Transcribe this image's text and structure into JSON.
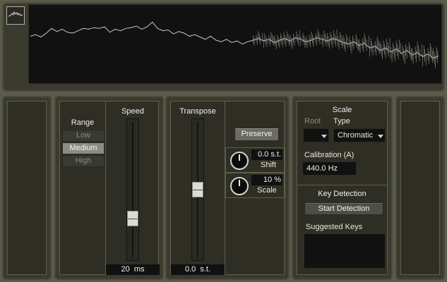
{
  "waveform": {
    "icon": "waveform-icon",
    "points": [
      0.4,
      0.38,
      0.41,
      0.36,
      0.3,
      0.34,
      0.31,
      0.35,
      0.36,
      0.33,
      0.3,
      0.31,
      0.29,
      0.3,
      0.28,
      0.35,
      0.31,
      0.33,
      0.3,
      0.29,
      0.27,
      0.31,
      0.28,
      0.22,
      0.3,
      0.33,
      0.32,
      0.37,
      0.34,
      0.36,
      0.4,
      0.38,
      0.41,
      0.44,
      0.4,
      0.45,
      0.47,
      0.44,
      0.48,
      0.46,
      0.5,
      0.47,
      0.45,
      0.43,
      0.46,
      0.44,
      0.48,
      0.45,
      0.43,
      0.46,
      0.42,
      0.44,
      0.47,
      0.45,
      0.42,
      0.44,
      0.46,
      0.43,
      0.45,
      0.48,
      0.5,
      0.47,
      0.52,
      0.49,
      0.55,
      0.53,
      0.58,
      0.55,
      0.6,
      0.56,
      0.62,
      0.58,
      0.64,
      0.61,
      0.66,
      0.63,
      0.68,
      0.65
    ]
  },
  "range": {
    "title": "Range",
    "options": [
      "Low",
      "Medium",
      "High"
    ],
    "selected": "Medium"
  },
  "speed": {
    "title": "Speed",
    "value": "20",
    "unit": "ms",
    "level": 0.27
  },
  "transpose": {
    "title": "Transpose",
    "value": "0.0",
    "unit": "s.t.",
    "level": 0.5,
    "preserve_label": "Preserve",
    "shift_value": "0.0 s.t.",
    "shift_label": "Shift",
    "scale_value": "10 %",
    "scale_label": "Scale"
  },
  "scale": {
    "title": "Scale",
    "root_label": "Root",
    "root_value": "",
    "type_label": "Type",
    "type_value": "Chromatic",
    "calibration_label": "Calibration (A)",
    "calibration_value": "440.0  Hz"
  },
  "key_detection": {
    "title": "Key Detection",
    "start_label": "Start Detection",
    "suggested_label": "Suggested Keys",
    "suggested_keys": ""
  }
}
